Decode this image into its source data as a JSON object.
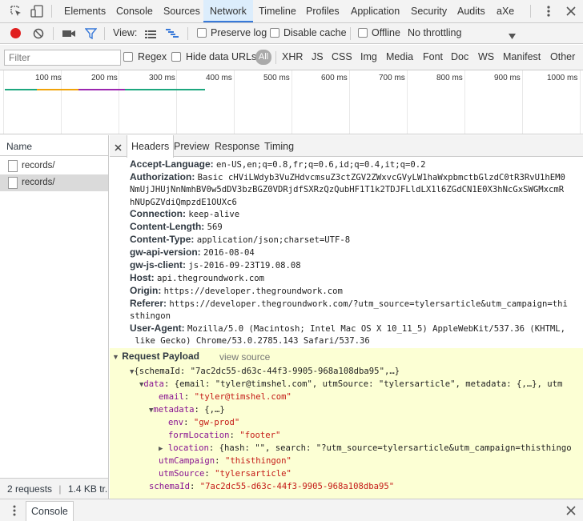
{
  "tabs": [
    "Elements",
    "Console",
    "Sources",
    "Network",
    "Timeline",
    "Profiles",
    "Application",
    "Security",
    "Audits",
    "aXe"
  ],
  "active_tab": "Network",
  "toolbar": {
    "view_label": "View:",
    "preserve_log": "Preserve log",
    "disable_cache": "Disable cache",
    "offline": "Offline",
    "throttling": "No throttling"
  },
  "filter": {
    "placeholder": "Filter",
    "regex": "Regex",
    "hide_data_urls": "Hide data URLs",
    "all": "All",
    "types": [
      "XHR",
      "JS",
      "CSS",
      "Img",
      "Media",
      "Font",
      "Doc",
      "WS",
      "Manifest",
      "Other"
    ]
  },
  "timeline_ticks": [
    "100 ms",
    "200 ms",
    "300 ms",
    "400 ms",
    "500 ms",
    "600 ms",
    "700 ms",
    "800 ms",
    "900 ms",
    "1000 ms"
  ],
  "requests": {
    "column_name": "Name",
    "items": [
      "records/",
      "records/"
    ],
    "status": "2 requests",
    "transferred": "1.4 KB tr..."
  },
  "detail_tabs": [
    "Headers",
    "Preview",
    "Response",
    "Timing"
  ],
  "headers": [
    {
      "k": "Accept-Language:",
      "v": "en-US,en;q=0.8,fr;q=0.6,id;q=0.4,it;q=0.2"
    },
    {
      "k": "Authorization:",
      "v": "Basic cHViLWdyb3VuZHdvcmsuZ3ctZGV2ZWxvcGVyLW1haWxpbmctbGlzdC0tR3RvU1hEM0"
    },
    {
      "k": "",
      "v": "NmUjJHUjNnNmhBV0w5dDV3bzBGZ0VDRjdfSXRzQzQubHF1T1k2TDJFLldLX1l6ZGdCN1E0X3hNcGxSWGMxcmR"
    },
    {
      "k": "",
      "v": "hNUpGZVdiQmpzdE1OUXc6"
    },
    {
      "k": "Connection:",
      "v": "keep-alive"
    },
    {
      "k": "Content-Length:",
      "v": "569"
    },
    {
      "k": "Content-Type:",
      "v": "application/json;charset=UTF-8"
    },
    {
      "k": "gw-api-version:",
      "v": "2016-08-04"
    },
    {
      "k": "gw-js-client:",
      "v": "js-2016-09-23T19.08.08"
    },
    {
      "k": "Host:",
      "v": "api.thegroundwork.com"
    },
    {
      "k": "Origin:",
      "v": "https://developer.thegroundwork.com"
    },
    {
      "k": "Referer:",
      "v": "https://developer.thegroundwork.com/?utm_source=tylersarticle&utm_campaign=thi"
    },
    {
      "k": "",
      "v": "sthingon"
    },
    {
      "k": "User-Agent:",
      "v": "Mozilla/5.0 (Macintosh; Intel Mac OS X 10_11_5) AppleWebKit/537.36 (KHTML,"
    },
    {
      "k": "",
      "v": " like Gecko) Chrome/53.0.2785.143 Safari/537.36"
    }
  ],
  "payload": {
    "title": "Request Payload",
    "view_source": "view source",
    "root": "{schemaId: \"7ac2dc55-d63c-44f3-9905-968a108dba95\",…}",
    "data_key": "data",
    "data_summary": "{email: \"tyler@timshel.com\", utmSource: \"tylersarticle\", metadata: {,…}, utm",
    "email_key": "email",
    "email_val": "\"tyler@timshel.com\"",
    "metadata_key": "metadata",
    "metadata_summary": "{,…}",
    "env_key": "env",
    "env_val": "\"gw-prod\"",
    "formLocation_key": "formLocation",
    "formLocation_val": "\"footer\"",
    "location_key": "location",
    "location_summary": "{hash: \"\", search: \"?utm_source=tylersarticle&utm_campaign=thisthingo",
    "utmCampaign_key": "utmCampaign",
    "utmCampaign_val": "\"thisthingon\"",
    "utmSource_key": "utmSource",
    "utmSource_val": "\"tylersarticle\"",
    "schemaId_key": "schemaId",
    "schemaId_val": "\"7ac2dc55-d63c-44f3-9905-968a108dba95\""
  },
  "drawer": {
    "console": "Console"
  },
  "colors": {
    "accent": "#3879d9",
    "record_red": "#e02020",
    "payload_bg": "#fcffd4",
    "key_purple": "#881391",
    "string_red": "#c41a16"
  }
}
